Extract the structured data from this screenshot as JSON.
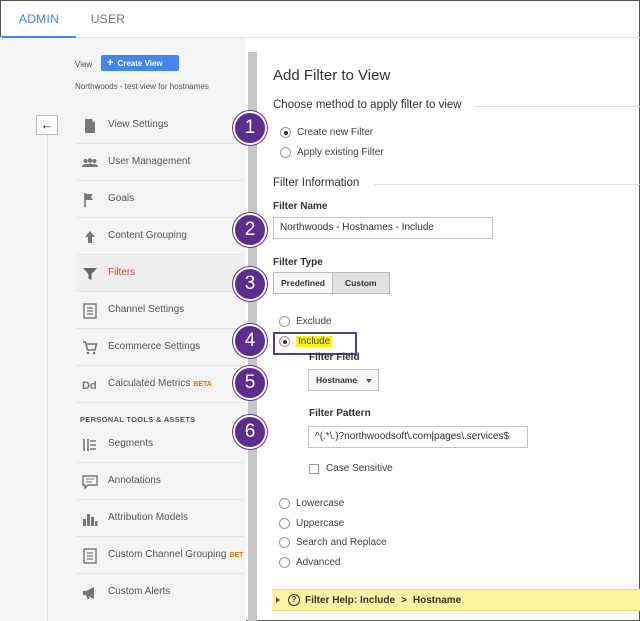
{
  "tabs": {
    "admin": "ADMIN",
    "user": "USER"
  },
  "sidebar": {
    "view_label": "View",
    "create_view": "Create View",
    "view_name": "Northwoods - test view for hostnames",
    "section_personal": "PERSONAL TOOLS & ASSETS",
    "items": [
      {
        "label": "View Settings",
        "icon": "document-icon"
      },
      {
        "label": "User Management",
        "icon": "users-icon"
      },
      {
        "label": "Goals",
        "icon": "flag-icon"
      },
      {
        "label": "Content Grouping",
        "icon": "content-grouping-icon"
      },
      {
        "label": "Filters",
        "icon": "filter-icon",
        "active": true
      },
      {
        "label": "Channel Settings",
        "icon": "channel-settings-icon"
      },
      {
        "label": "Ecommerce Settings",
        "icon": "cart-icon"
      },
      {
        "label": "Calculated Metrics",
        "badge": "BETA",
        "icon": "calculated-metrics-icon"
      },
      {
        "label": "Segments",
        "icon": "segments-icon"
      },
      {
        "label": "Annotations",
        "icon": "annotation-icon"
      },
      {
        "label": "Attribution Models",
        "icon": "bar-chart-icon"
      },
      {
        "label": "Custom Channel Grouping",
        "badge": "BET",
        "icon": "channel-grouping-icon"
      },
      {
        "label": "Custom Alerts",
        "icon": "megaphone-icon"
      }
    ]
  },
  "main": {
    "title": "Add Filter to View",
    "method_heading": "Choose method to apply filter to view",
    "method_options": [
      "Create new Filter",
      "Apply existing Filter"
    ],
    "info_heading": "Filter Information",
    "filter_name_label": "Filter Name",
    "filter_name_value": "Northwoods - Hostnames - Include",
    "filter_type_label": "Filter Type",
    "filter_type_options": [
      "Predefined",
      "Custom"
    ],
    "custom_options": [
      "Exclude",
      "Include"
    ],
    "filter_field_label": "Filter Field",
    "filter_field_value": "Hostname",
    "filter_pattern_label": "Filter Pattern",
    "filter_pattern_value": "^(.*\\.)?northwoodsoft\\.com|pages\\.services$",
    "case_sensitive": "Case Sensitive",
    "other_options": [
      "Lowercase",
      "Uppercase",
      "Search and Replace",
      "Advanced"
    ],
    "help_prefix": "Filter Help: Include",
    "help_sep": ">",
    "help_suffix": "Hostname"
  },
  "steps": [
    "1",
    "2",
    "3",
    "4",
    "5",
    "6"
  ],
  "colors": {
    "accent": "#4285f4",
    "active": "#db4437",
    "step": "#5c2d91",
    "highlight": "#fff200"
  }
}
